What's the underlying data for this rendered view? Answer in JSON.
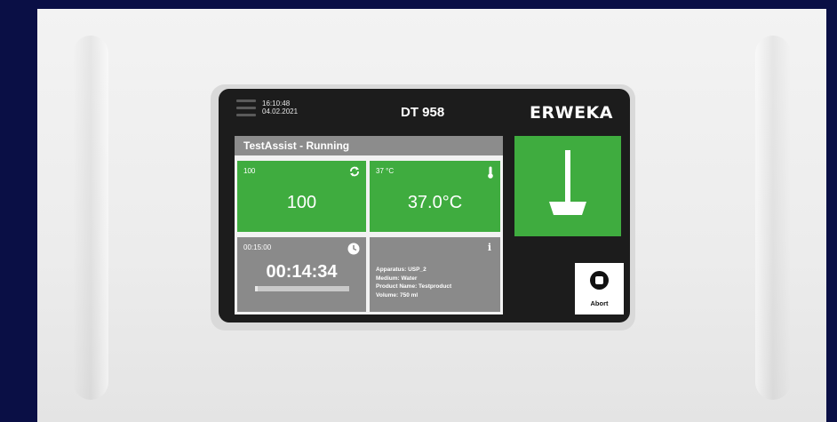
{
  "header": {
    "time": "16:10:48",
    "date": "04.02.2021",
    "model": "DT 958",
    "brand": "ERWEKA"
  },
  "panel": {
    "title": "TestAssist - Running"
  },
  "tiles": {
    "speed": {
      "setpoint": "100",
      "value": "100",
      "icon": "rotate-icon"
    },
    "temperature": {
      "setpoint": "37 °C",
      "value": "37.0°C",
      "icon": "thermometer-icon"
    },
    "timer": {
      "setpoint": "00:15:00",
      "value": "00:14:34",
      "progress": 0.03,
      "icon": "clock-icon"
    },
    "info": {
      "apparatus": "Apparatus: USP_2",
      "medium": "Medium: Water",
      "product": "Product Name: Testproduct",
      "volume": "Volume: 750 ml",
      "icon": "info-icon"
    }
  },
  "buttons": {
    "stirrer_icon": "paddle-icon",
    "abort_label": "Abort"
  },
  "colors": {
    "green": "#3fac3f",
    "grey": "#8a8a8a",
    "screen": "#1c1c1c",
    "background": "#0a0f45"
  }
}
